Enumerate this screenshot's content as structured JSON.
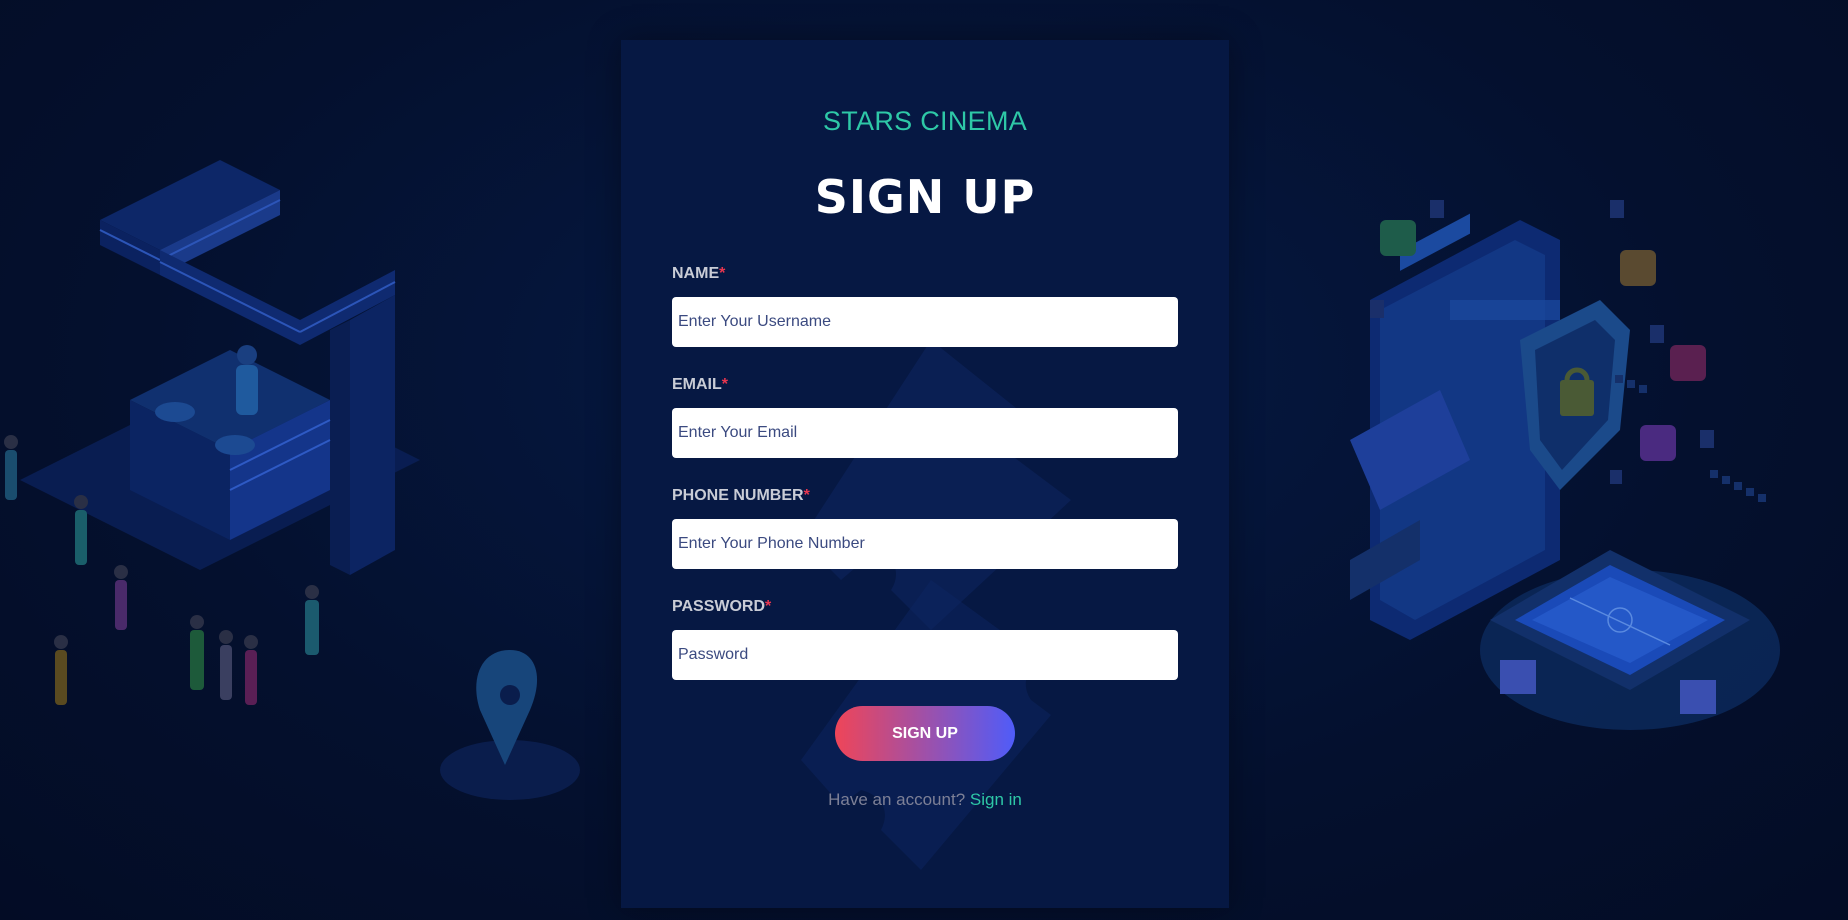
{
  "colors": {
    "background": "#04102e",
    "card": "#061843",
    "brand": "#2ec8a7",
    "required": "#e8364f",
    "button_start": "#ef4558",
    "button_end": "#4f5cf9"
  },
  "header": {
    "brand": "STARS CINEMA",
    "title": "SIGN UP"
  },
  "form": {
    "required_mark": "*",
    "fields": [
      {
        "label": "NAME",
        "placeholder": "Enter Your Username",
        "value": ""
      },
      {
        "label": "EMAIL",
        "placeholder": "Enter Your Email",
        "value": ""
      },
      {
        "label": "PHONE NUMBER",
        "placeholder": "Enter Your Phone Number",
        "value": ""
      },
      {
        "label": "PASSWORD",
        "placeholder": "Password",
        "value": ""
      }
    ],
    "submit_label": "SIGN UP"
  },
  "footer": {
    "prompt": "Have an account?",
    "link_label": "Sign in"
  },
  "icons": {
    "left_illustration": "party-club-illustration",
    "right_illustration": "security-stadium-illustration",
    "card_watermark": "ticket-watermark"
  }
}
